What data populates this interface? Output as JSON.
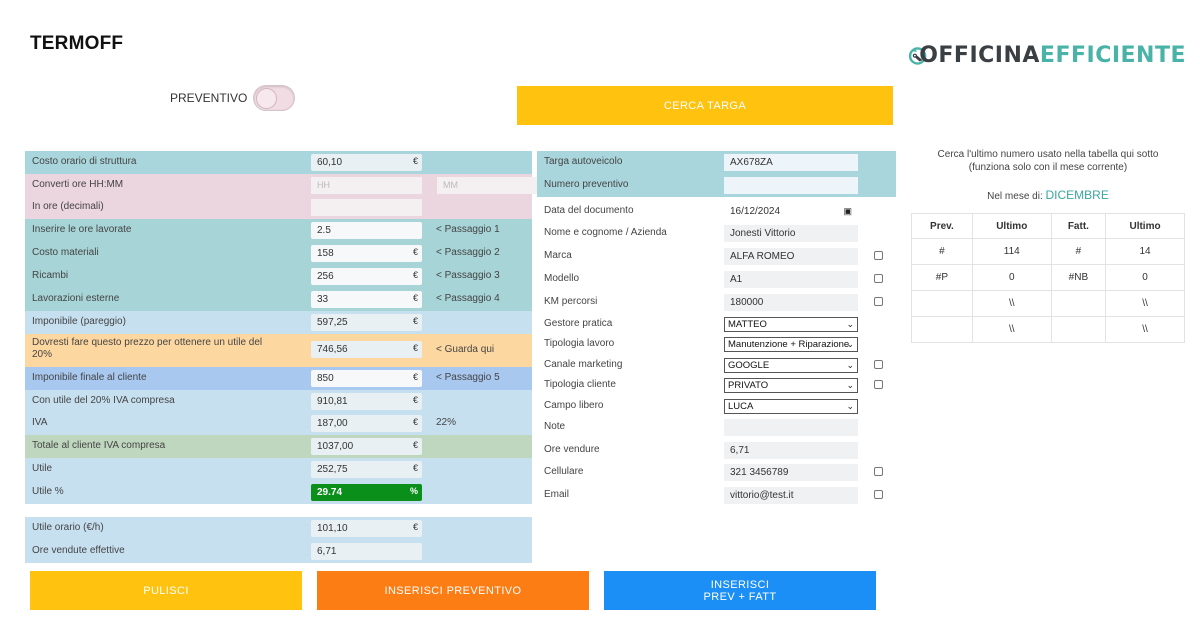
{
  "app_title": "TERMOFF",
  "logo": {
    "part1": "OFFICINA",
    "part2": "EFFICIENTE"
  },
  "toggle": {
    "label": "PREVENTIVO",
    "checked": false
  },
  "buttons": {
    "cerca_targa": "CERCA TARGA",
    "pulisci": "PULISCI",
    "inserisci_preventivo": "INSERISCI PREVENTIVO",
    "inserisci_prev_fatt_line1": "INSERISCI",
    "inserisci_prev_fatt_line2": "PREV + FATT"
  },
  "left": {
    "costo_orario": {
      "label": "Costo orario di struttura",
      "value": "60,10",
      "unit": "€"
    },
    "converti": {
      "label": "Converti ore HH:MM",
      "hh_placeholder": "HH",
      "mm_placeholder": "MM"
    },
    "in_ore": {
      "label": "In ore (decimali)",
      "value": ""
    },
    "ore_lavorate": {
      "label": "Inserire le ore lavorate",
      "value": "2.5",
      "note": "< Passaggio 1"
    },
    "costo_materiali": {
      "label": "Costo materiali",
      "value": "158",
      "unit": "€",
      "note": "< Passaggio 2"
    },
    "ricambi": {
      "label": "Ricambi",
      "value": "256",
      "unit": "€",
      "note": "< Passaggio 3"
    },
    "lavorazioni_esterne": {
      "label": "Lavorazioni esterne",
      "value": "33",
      "unit": "€",
      "note": "< Passaggio 4"
    },
    "imponibile_pareggio": {
      "label": "Imponibile (pareggio)",
      "value": "597,25",
      "unit": "€"
    },
    "dovresti": {
      "label_line1": "Dovresti fare questo prezzo per ottenere un utile del",
      "label_line2": "20%",
      "value": "746,56",
      "unit": "€",
      "note": "< Guarda qui"
    },
    "imponibile_finale": {
      "label": "Imponibile finale al cliente",
      "value": "850",
      "unit": "€",
      "note": "< Passaggio 5"
    },
    "con_utile": {
      "label": "Con utile del 20% IVA compresa",
      "value": "910,81",
      "unit": "€"
    },
    "iva": {
      "label": "IVA",
      "value": "187,00",
      "unit": "€",
      "note": "22%"
    },
    "totale": {
      "label": "Totale al cliente IVA compresa",
      "value": "1037,00",
      "unit": "€"
    },
    "utile": {
      "label": "Utile",
      "value": "252,75",
      "unit": "€"
    },
    "utile_pct": {
      "label": "Utile %",
      "value": "29.74",
      "unit": "%"
    },
    "utile_orario": {
      "label": "Utile orario (€/h)",
      "value": "101,10",
      "unit": "€"
    },
    "ore_vendute_effettive": {
      "label": "Ore vendute effettive",
      "value": "6,71"
    }
  },
  "middle": {
    "targa": {
      "label": "Targa autoveicolo",
      "value": "AX678ZA"
    },
    "numero_preventivo": {
      "label": "Numero preventivo",
      "value": ""
    },
    "data_documento": {
      "label": "Data del documento",
      "value": "16/12/2024"
    },
    "nome": {
      "label": "Nome e cognome / Azienda",
      "value": "Jonesti Vittorio"
    },
    "marca": {
      "label": "Marca",
      "value": "ALFA ROMEO"
    },
    "modello": {
      "label": "Modello",
      "value": "A1"
    },
    "km": {
      "label": "KM percorsi",
      "value": "180000"
    },
    "gestore": {
      "label": "Gestore pratica",
      "value": "MATTEO"
    },
    "tipologia_lavoro": {
      "label": "Tipologia lavoro",
      "value": "Manutenzione + Riparazione"
    },
    "canale": {
      "label": "Canale marketing",
      "value": "GOOGLE"
    },
    "tipologia_cliente": {
      "label": "Tipologia cliente",
      "value": "PRIVATO"
    },
    "campo_libero": {
      "label": "Campo libero",
      "value": "LUCA"
    },
    "note": {
      "label": "Note",
      "value": ""
    },
    "ore_vendure": {
      "label": "Ore vendure",
      "value": "6,71"
    },
    "cellulare": {
      "label": "Cellulare",
      "value": "321 3456789"
    },
    "email": {
      "label": "Email",
      "value": "vittorio@test.it"
    }
  },
  "right": {
    "info_line1": "Cerca l'ultimo numero usato nella tabella qui sotto",
    "info_line2": "(funziona solo con il mese corrente)",
    "mese_label": "Nel mese di:",
    "mese_value": "DICEMBRE",
    "table": {
      "headers": [
        "Prev.",
        "Ultimo",
        "Fatt.",
        "Ultimo"
      ],
      "rows": [
        [
          "#",
          "114",
          "#",
          "14"
        ],
        [
          "#P",
          "0",
          "#NB",
          "0"
        ],
        [
          "",
          "\\\\",
          "",
          "\\\\"
        ],
        [
          "",
          "\\\\",
          "",
          "\\\\"
        ]
      ]
    }
  },
  "colors": {
    "yellow_button": "#ffc20e",
    "orange_button": "#fb7d14",
    "blue_button": "#1b8ff5",
    "cyan_row": "#a9d6dc",
    "pink_row": "#ebd5de",
    "teal_row": "#a7d4d6",
    "light_blue_row": "#c7e0f0",
    "orange_row": "#fdd7a0",
    "blue_row": "#a8c8f0",
    "green_row": "#bfd7bf",
    "utile_pct_green": "#0a8f1a",
    "logo_teal": "#4ab3a8"
  }
}
